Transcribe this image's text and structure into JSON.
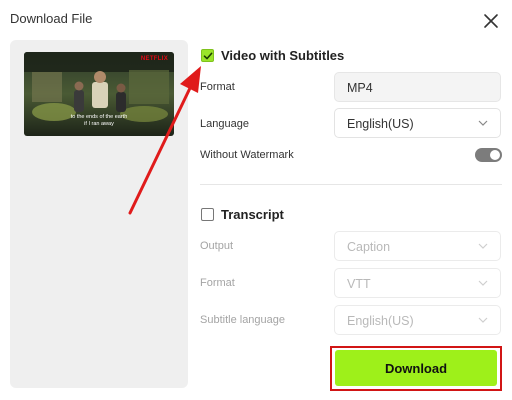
{
  "dialog": {
    "title": "Download File",
    "close_icon": "close-icon"
  },
  "preview": {
    "badge": "NETFLIX",
    "caption_line1": "to the ends of the earth",
    "caption_line2": "if I ran away"
  },
  "video_section": {
    "checked": true,
    "label": "Video with Subtitles",
    "format_label": "Format",
    "format_value": "MP4",
    "language_label": "Language",
    "language_value": "English(US)",
    "watermark_label": "Without Watermark",
    "watermark_on": true
  },
  "transcript_section": {
    "checked": false,
    "label": "Transcript",
    "output_label": "Output",
    "output_value": "Caption",
    "format_label": "Format",
    "format_value": "VTT",
    "subtitle_language_label": "Subtitle language",
    "subtitle_language_value": "English(US)"
  },
  "download_button": {
    "label": "Download"
  },
  "colors": {
    "accent_green": "#9ef01a",
    "highlight_red": "#d11515",
    "toggle_on": "#7c7c7c"
  }
}
